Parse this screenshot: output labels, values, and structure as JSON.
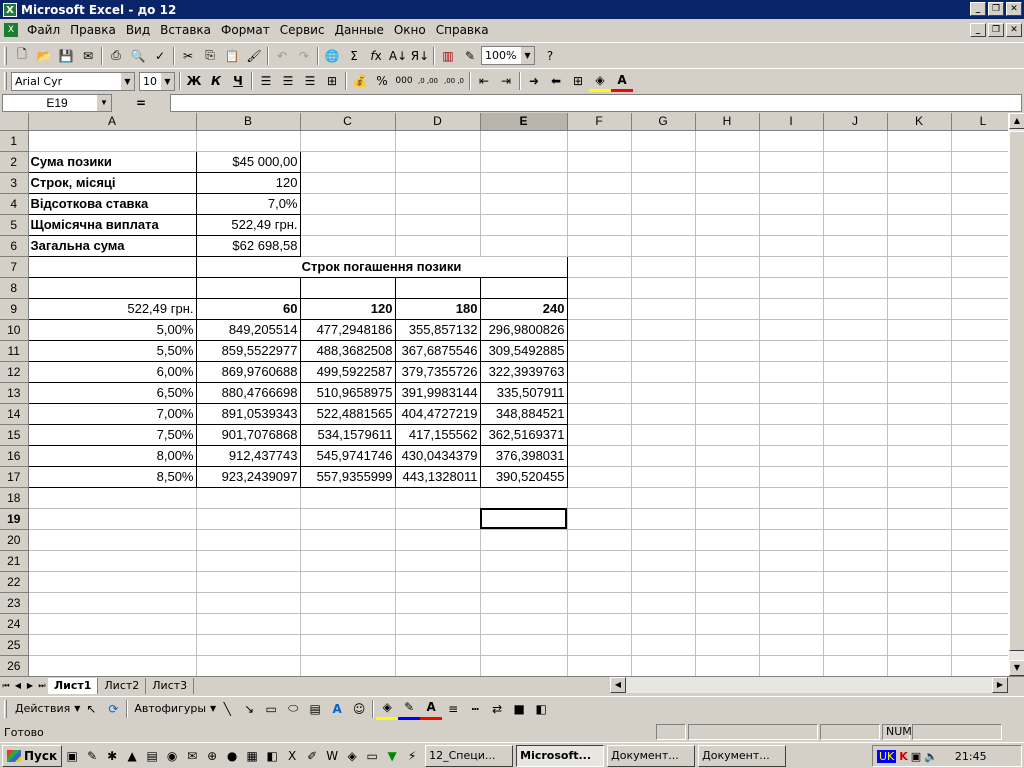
{
  "window": {
    "title": "Microsoft Excel - до 12",
    "app_icon": "X"
  },
  "menu": [
    "Файл",
    "Правка",
    "Вид",
    "Вставка",
    "Формат",
    "Сервис",
    "Данные",
    "Окно",
    "Справка"
  ],
  "toolbar": {
    "zoom": "100%"
  },
  "format_toolbar": {
    "font": "Arial Cyr",
    "size": "10",
    "bold": "Ж",
    "italic": "К",
    "underline": "Ч",
    "thousands": "000",
    "inc_dec": ",0 ,00",
    "dec_dec": ",00 ,0"
  },
  "formula_bar": {
    "name_box": "E19",
    "equals": "=",
    "value": ""
  },
  "columns": [
    "A",
    "B",
    "C",
    "D",
    "E",
    "F",
    "G",
    "H",
    "I",
    "J",
    "K",
    "L"
  ],
  "rows": [
    "1",
    "2",
    "3",
    "4",
    "5",
    "6",
    "7",
    "8",
    "9",
    "10",
    "11",
    "12",
    "13",
    "14",
    "15",
    "16",
    "17",
    "18",
    "19",
    "20",
    "21",
    "22",
    "23",
    "24",
    "25",
    "26"
  ],
  "cells": {
    "A2": "Сума позики",
    "B2": "$45 000,00",
    "A3": "Строк, місяці",
    "B3": "120",
    "A4": "Відсоткова ставка",
    "B4": "7,0%",
    "A5": "Щомісячна виплата",
    "B5": "522,49 грн.",
    "A6": "Загальна сума",
    "B6": "$62 698,58",
    "B7": "Строк погашення позики",
    "A9": "522,49 грн.",
    "B9": "60",
    "C9": "120",
    "D9": "180",
    "E9": "240"
  },
  "table": [
    [
      "5,00%",
      "849,205514",
      "477,2948186",
      "355,857132",
      "296,9800826"
    ],
    [
      "5,50%",
      "859,5522977",
      "488,3682508",
      "367,6875546",
      "309,5492885"
    ],
    [
      "6,00%",
      "869,9760688",
      "499,5922587",
      "379,7355726",
      "322,3939763"
    ],
    [
      "6,50%",
      "880,4766698",
      "510,9658975",
      "391,9983144",
      "335,507911"
    ],
    [
      "7,00%",
      "891,0539343",
      "522,4881565",
      "404,4727219",
      "348,884521"
    ],
    [
      "7,50%",
      "901,7076868",
      "534,1579611",
      "417,155562",
      "362,5169371"
    ],
    [
      "8,00%",
      "912,437743",
      "545,9741746",
      "430,0434379",
      "376,398031"
    ],
    [
      "8,50%",
      "923,2439097",
      "557,9355999",
      "443,1328011",
      "390,520455"
    ]
  ],
  "sheets": [
    "Лист1",
    "Лист2",
    "Лист3"
  ],
  "drawing": {
    "actions": "Действия",
    "autoshapes": "Автофигуры"
  },
  "status": {
    "text": "Готово",
    "num": "NUM"
  },
  "taskbar": {
    "start": "Пуск",
    "tasks": [
      "12_Специ...",
      "Microsoft...",
      "Документ...",
      "Документ..."
    ],
    "lang": "UK",
    "clock": "21:45"
  }
}
